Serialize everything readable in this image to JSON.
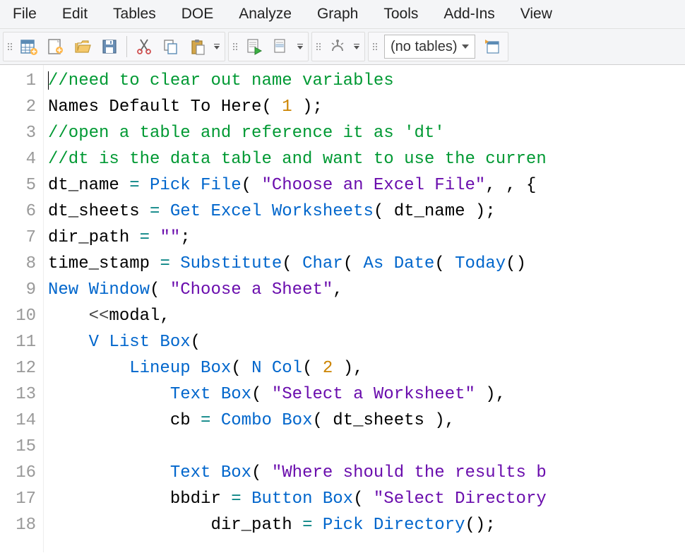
{
  "menu": {
    "items": [
      "File",
      "Edit",
      "Tables",
      "DOE",
      "Analyze",
      "Graph",
      "Tools",
      "Add-Ins",
      "View"
    ]
  },
  "toolbar": {
    "group1": [
      "new-table-icon",
      "new-script-icon",
      "open-icon",
      "save-icon"
    ],
    "group1b": [
      "cut-icon",
      "copy-icon",
      "paste-icon"
    ],
    "group2": [
      "run-script-icon",
      "run-selection-icon"
    ],
    "group3": [
      "debug-icon"
    ],
    "table_selector": "(no tables)",
    "insert_icon": "insert-table-icon"
  },
  "code": {
    "lines": [
      {
        "n": 1,
        "tokens": [
          {
            "t": "comment",
            "v": "//need to clear out name variables"
          }
        ]
      },
      {
        "n": 2,
        "tokens": [
          {
            "t": "ident",
            "v": "Names Default To Here"
          },
          {
            "t": "ident",
            "v": "( "
          },
          {
            "t": "number",
            "v": "1"
          },
          {
            "t": "ident",
            "v": " );"
          }
        ]
      },
      {
        "n": 3,
        "tokens": [
          {
            "t": "comment",
            "v": "//open a table and reference it as 'dt'"
          }
        ]
      },
      {
        "n": 4,
        "tokens": [
          {
            "t": "comment",
            "v": "//dt is the data table and want to use the curren"
          }
        ]
      },
      {
        "n": 5,
        "tokens": [
          {
            "t": "ident",
            "v": "dt_name "
          },
          {
            "t": "op",
            "v": "="
          },
          {
            "t": "ident",
            "v": " "
          },
          {
            "t": "func",
            "v": "Pick File"
          },
          {
            "t": "ident",
            "v": "( "
          },
          {
            "t": "string",
            "v": "\"Choose an Excel File\""
          },
          {
            "t": "ident",
            "v": ", , {"
          }
        ]
      },
      {
        "n": 6,
        "tokens": [
          {
            "t": "ident",
            "v": "dt_sheets "
          },
          {
            "t": "op",
            "v": "="
          },
          {
            "t": "ident",
            "v": " "
          },
          {
            "t": "func",
            "v": "Get Excel Worksheets"
          },
          {
            "t": "ident",
            "v": "( dt_name );"
          }
        ]
      },
      {
        "n": 7,
        "tokens": [
          {
            "t": "ident",
            "v": "dir_path "
          },
          {
            "t": "op",
            "v": "="
          },
          {
            "t": "ident",
            "v": " "
          },
          {
            "t": "string",
            "v": "\"\""
          },
          {
            "t": "ident",
            "v": ";"
          }
        ]
      },
      {
        "n": 8,
        "tokens": [
          {
            "t": "ident",
            "v": "time_stamp "
          },
          {
            "t": "op",
            "v": "="
          },
          {
            "t": "ident",
            "v": " "
          },
          {
            "t": "func",
            "v": "Substitute"
          },
          {
            "t": "ident",
            "v": "( "
          },
          {
            "t": "func",
            "v": "Char"
          },
          {
            "t": "ident",
            "v": "( "
          },
          {
            "t": "func",
            "v": "As Date"
          },
          {
            "t": "ident",
            "v": "( "
          },
          {
            "t": "func",
            "v": "Today"
          },
          {
            "t": "ident",
            "v": "() "
          }
        ]
      },
      {
        "n": 9,
        "tokens": [
          {
            "t": "func",
            "v": "New Window"
          },
          {
            "t": "ident",
            "v": "( "
          },
          {
            "t": "string",
            "v": "\"Choose a Sheet\""
          },
          {
            "t": "ident",
            "v": ","
          }
        ]
      },
      {
        "n": 10,
        "tokens": [
          {
            "t": "ident",
            "v": "    "
          },
          {
            "t": "lt",
            "v": "<<"
          },
          {
            "t": "ident",
            "v": "modal,"
          }
        ]
      },
      {
        "n": 11,
        "tokens": [
          {
            "t": "ident",
            "v": "    "
          },
          {
            "t": "func",
            "v": "V List Box"
          },
          {
            "t": "ident",
            "v": "("
          }
        ]
      },
      {
        "n": 12,
        "tokens": [
          {
            "t": "ident",
            "v": "        "
          },
          {
            "t": "func",
            "v": "Lineup Box"
          },
          {
            "t": "ident",
            "v": "( "
          },
          {
            "t": "func",
            "v": "N Col"
          },
          {
            "t": "ident",
            "v": "( "
          },
          {
            "t": "number",
            "v": "2"
          },
          {
            "t": "ident",
            "v": " ),"
          }
        ]
      },
      {
        "n": 13,
        "tokens": [
          {
            "t": "ident",
            "v": "            "
          },
          {
            "t": "func",
            "v": "Text Box"
          },
          {
            "t": "ident",
            "v": "( "
          },
          {
            "t": "string",
            "v": "\"Select a Worksheet\""
          },
          {
            "t": "ident",
            "v": " ),"
          }
        ]
      },
      {
        "n": 14,
        "tokens": [
          {
            "t": "ident",
            "v": "            cb "
          },
          {
            "t": "op",
            "v": "="
          },
          {
            "t": "ident",
            "v": " "
          },
          {
            "t": "func",
            "v": "Combo Box"
          },
          {
            "t": "ident",
            "v": "( dt_sheets ),"
          }
        ]
      },
      {
        "n": 15,
        "tokens": []
      },
      {
        "n": 16,
        "tokens": [
          {
            "t": "ident",
            "v": "            "
          },
          {
            "t": "func",
            "v": "Text Box"
          },
          {
            "t": "ident",
            "v": "( "
          },
          {
            "t": "string",
            "v": "\"Where should the results b"
          }
        ]
      },
      {
        "n": 17,
        "tokens": [
          {
            "t": "ident",
            "v": "            bbdir "
          },
          {
            "t": "op",
            "v": "="
          },
          {
            "t": "ident",
            "v": " "
          },
          {
            "t": "func",
            "v": "Button Box"
          },
          {
            "t": "ident",
            "v": "( "
          },
          {
            "t": "string",
            "v": "\"Select Directory"
          }
        ]
      },
      {
        "n": 18,
        "tokens": [
          {
            "t": "ident",
            "v": "                dir_path "
          },
          {
            "t": "op",
            "v": "="
          },
          {
            "t": "ident",
            "v": " "
          },
          {
            "t": "func",
            "v": "Pick Directory"
          },
          {
            "t": "ident",
            "v": "();"
          }
        ]
      }
    ]
  },
  "colors": {
    "comment": "#009933",
    "keyword": "#0066cc",
    "number": "#cc8400",
    "string": "#6a0dad",
    "operator": "#008080"
  }
}
